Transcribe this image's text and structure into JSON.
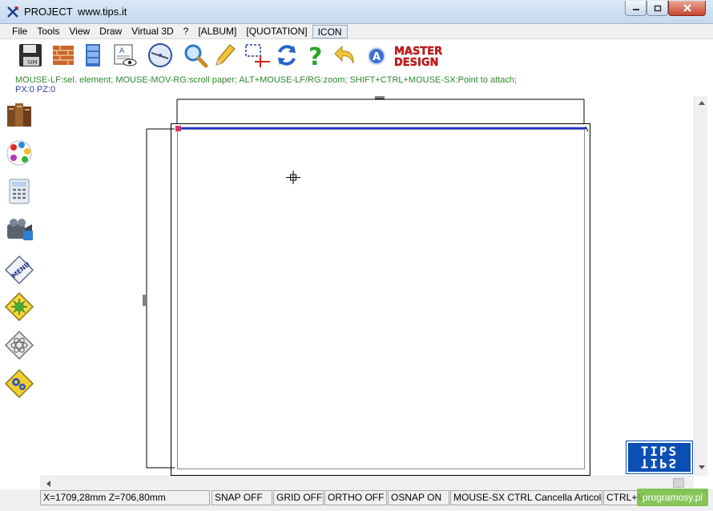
{
  "window": {
    "title": "PROJECT",
    "url": "www.tips.it"
  },
  "menu": {
    "items": [
      "File",
      "Tools",
      "View",
      "Draw",
      "Virtual 3D",
      "?",
      "[ALBUM]",
      "[QUOTATION]",
      "ICON"
    ],
    "selected": "ICON"
  },
  "toolbar": {
    "master_design_logo": "MASTER DESIGN"
  },
  "hint": "MOUSE-LF:sel. element; MOUSE-MOV-RG:scroll paper; ALT+MOUSE-LF/RG:zoom; SHIFT+CTRL+MOUSE-SX:Point to attach;",
  "position_readout": "PX:0 PZ:0",
  "status": {
    "coords": "X=1709,28mm    Z=706,80mm",
    "snap": "SNAP OFF",
    "grid": "GRID OFF",
    "ortho": "ORTHO OFF",
    "osnap": "OSNAP ON",
    "mouse_hint": "MOUSE-SX CTRL Cancella Articolo",
    "ctrl_hint": "CTRL+M"
  },
  "tips_logo": "TIPS",
  "watermark": "programosy.pl",
  "colors": {
    "hint_text": "#2f8a2f",
    "coord_text": "#2d3ea8",
    "wall_line": "#1c2fd8",
    "tips_blue": "#0b4fb5"
  }
}
